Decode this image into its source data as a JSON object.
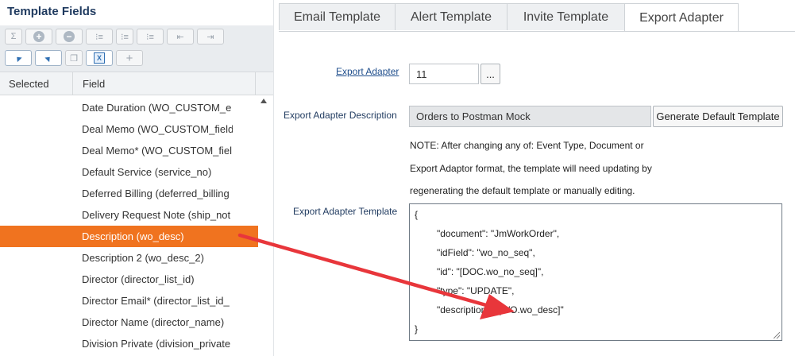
{
  "left_panel": {
    "title": "Template Fields",
    "toolbar_row1": [
      {
        "icon": "sum-icon",
        "glyph": "Σ"
      },
      {
        "icon": "add-circle-icon",
        "glyph": "+"
      },
      {
        "icon": "remove-circle-icon",
        "glyph": "−"
      },
      {
        "icon": "list-indent-icon",
        "glyph": "⁝≡"
      },
      {
        "icon": "list-indent-2-icon",
        "glyph": "⁝≡"
      },
      {
        "icon": "list-indent-3-icon",
        "glyph": "⁝≡"
      },
      {
        "icon": "outdent-icon",
        "glyph": "⇤"
      },
      {
        "icon": "indent-icon",
        "glyph": "⇥"
      }
    ],
    "toolbar_row2": [
      {
        "icon": "collapse-down-icon"
      },
      {
        "icon": "expand-up-icon"
      },
      {
        "icon": "copy-icon",
        "glyph": "❐"
      },
      {
        "icon": "excel-icon",
        "glyph": "X"
      },
      {
        "icon": "plus-icon",
        "glyph": "+"
      }
    ],
    "columns": {
      "selected": "Selected",
      "field": "Field"
    },
    "fields": [
      "Date Duration (WO_CUSTOM_e",
      "Deal Memo (WO_CUSTOM_field",
      "Deal Memo* (WO_CUSTOM_fiel",
      "Default Service (service_no)",
      "Deferred Billing (deferred_billing",
      "Delivery Request Note (ship_not",
      "Description (wo_desc)",
      "Description 2 (wo_desc_2)",
      "Director (director_list_id)",
      "Director Email* (director_list_id_",
      "Director Name (director_name)",
      "Division Private (division_private"
    ],
    "selected_index": 6
  },
  "tabs": [
    "Email Template",
    "Alert Template",
    "Invite Template",
    "Export Adapter"
  ],
  "active_tab": 3,
  "form": {
    "export_adapter_label": "Export Adapter",
    "export_adapter_value": "11",
    "lookup_button": "...",
    "description_label": "Export Adapter Description",
    "description_value": "Orders to Postman Mock",
    "generate_button": "Generate Default Template",
    "note_lines": [
      "NOTE: After changing any of: Event Type, Document or",
      "Export Adaptor format, the template will need updating by",
      "regenerating the default template or manually editing."
    ],
    "template_label": "Export Adapter Template",
    "template_lines": [
      "{",
      "\"document\": \"JmWorkOrder\",",
      "\"idField\": \"wo_no_seq\",",
      "\"id\": \"[DOC.wo_no_seq]\",",
      "\"type\": \"UPDATE\",",
      "\"description\": \"[WO.wo_desc]\"",
      "}"
    ]
  },
  "colors": {
    "selection": "#f0731f",
    "arrow": "#e8363b",
    "title": "#1f3a5f"
  }
}
